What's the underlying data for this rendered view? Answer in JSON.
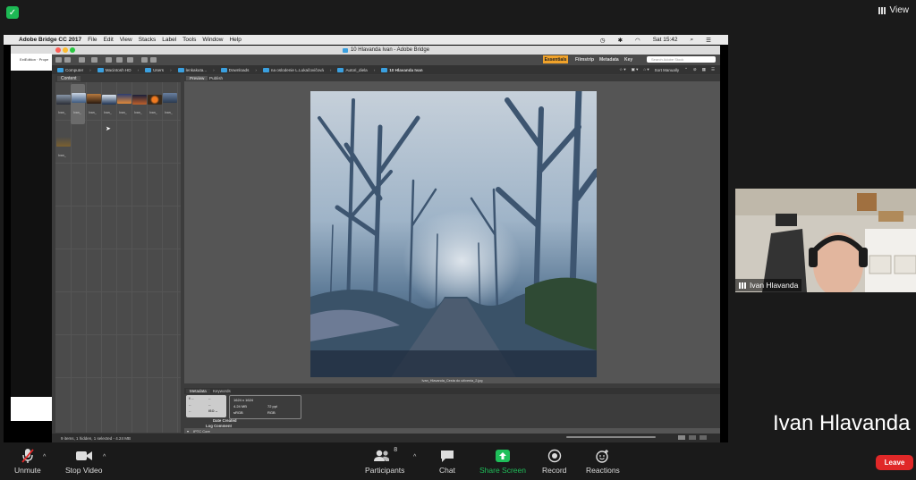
{
  "zoom_top": {
    "view_label": "View"
  },
  "mac_menubar": {
    "app": "Adobe Bridge CC 2017",
    "menus": [
      "File",
      "Edit",
      "View",
      "Stacks",
      "Label",
      "Tools",
      "Window",
      "Help"
    ],
    "clock": "Sat 15:42"
  },
  "browser": {
    "tab_text": "ExtEdition · Prope"
  },
  "bridge": {
    "window_title": "10 Hlavanda Ivan - Adobe Bridge",
    "workspaces": [
      "Essentials",
      "Filmstrip",
      "Metadata",
      "Key"
    ],
    "active_workspace": "Essentials",
    "search_placeholder": "Search Adobe Stock",
    "path": [
      "Computer",
      "Macintosh HD",
      "Users",
      "lenkakuta...",
      "Downloads",
      "na oslodenie L.Lukačovičová",
      "Autori_diela",
      "10 Hlavanda Ivan"
    ],
    "sort_label": "Sort Manually",
    "content_tab": "Content",
    "preview_tabs": [
      "Preview",
      "Publish"
    ],
    "thumb_labels": [
      "Ivan_",
      "Ivan_",
      "Ivan_",
      "Ivan_",
      "Ivan_",
      "Ivan_",
      "Ivan_",
      "Ivan_",
      "Ivan_"
    ],
    "photo_caption": "Ivan_Hlavanda_Cesta do oživenia_2.jpg",
    "metadata_tabs": [
      "Metadata",
      "Keywords"
    ],
    "meta_card": {
      "fstop": "f/ --",
      "dashes": "--",
      "iso": "ISO --",
      "dimensions": "1624 x 1624",
      "size": "4.24 MB",
      "ppi": "72 ppi",
      "color": "sRGB",
      "mode": "RGB"
    },
    "meta_labels": [
      "Date Created",
      "Log Comment"
    ],
    "iptc_label": "IPTC Core",
    "status_text": "9 items, 1 hidden, 1 selected - 4.24 MB"
  },
  "participant": {
    "name": "Ivan Hlavanda"
  },
  "presenter_name": "Ivan Hlavanda",
  "bottom_bar": {
    "unmute": "Unmute",
    "stop_video": "Stop Video",
    "participants": "Participants",
    "participant_count": "8",
    "chat": "Chat",
    "share_screen": "Share Screen",
    "record": "Record",
    "reactions": "Reactions",
    "leave": "Leave"
  },
  "colors": {
    "share_green": "#1fbf5a",
    "leave_red": "#e02828",
    "workspace_orange": "#f0a22a"
  }
}
